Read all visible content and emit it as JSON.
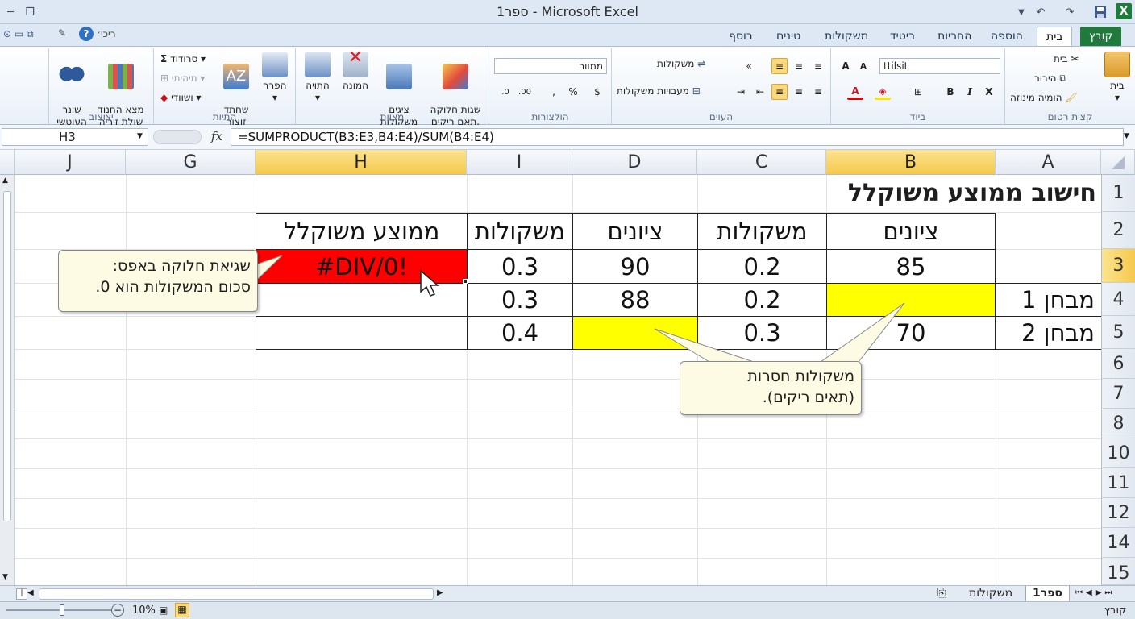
{
  "window": {
    "title": "ספר1 - Microsoft Excel"
  },
  "tabs": [
    {
      "label": "קובץ",
      "kind": "file"
    },
    {
      "label": "בית",
      "kind": "active"
    },
    {
      "label": "הוספה"
    },
    {
      "label": "החריות"
    },
    {
      "label": "ריטיד"
    },
    {
      "label": "משקולות"
    },
    {
      "label": "טינים"
    },
    {
      "label": "בוסף"
    }
  ],
  "qat": {
    "user": "ריכי׳"
  },
  "ribbon": {
    "clipboard": {
      "group": "קצית רטום",
      "paste": "בית",
      "cut": "בית",
      "copy": "היבור",
      "format_painter": "הומיה מינוזה"
    },
    "font": {
      "group": "ביוד",
      "font_name": "ttilsit"
    },
    "alignment": {
      "group": "העוים",
      "wrap": "משקולות",
      "merge": "מעבויות משקולות"
    },
    "number": {
      "group": "הולצורות",
      "format": "ממוור"
    },
    "styles": {
      "group": "מצוות",
      "b1": "שגות חלוקה\nתאם ריקים.",
      "b2": "ציגים\nמשקולות",
      "b3": "המונה",
      "b4": "התויה"
    },
    "cells": {
      "group": "התיות",
      "b1": "הפרר",
      "b2": "שחתד\nזוצור",
      "s1": "סרודוד",
      "s2": "תיהיתי",
      "s3": "ושוודי"
    },
    "editing": {
      "group": "יצוצוב",
      "b1": "מצא החנוד\nשולת זיריה",
      "b2": "שונר\nהעוטשי"
    }
  },
  "formula_bar": {
    "name_box": "H3",
    "fx": "fx",
    "formula": "=SUMPRODUCT(B3:E3,B4:E4)/SUM(B4:E4)"
  },
  "columns": [
    "A",
    "B",
    "C",
    "D",
    "I",
    "H",
    "G",
    "J"
  ],
  "rows": [
    "1",
    "2",
    "3",
    "4",
    "5",
    "6",
    "7",
    "8",
    "10",
    "11",
    "12",
    "14",
    "15"
  ],
  "sheet": {
    "title": "חישוב ממוצע משוקלל",
    "headers": {
      "B": "ציונים",
      "C": "משקולות",
      "D": "ציונים",
      "I": "משקולות",
      "H": "ממוצע משוקלל"
    },
    "row3": {
      "B": "85",
      "C": "0.2",
      "D": "90",
      "I": "0.3",
      "H": "#DIV/0!"
    },
    "row4": {
      "A": "מבחן 1",
      "B": "",
      "C": "0.2",
      "D": "88",
      "I": "0.3"
    },
    "row5": {
      "A": "מבחן 2",
      "B": "70",
      "C": "0.3",
      "D": "",
      "I": "0.4"
    }
  },
  "callouts": {
    "error": [
      "שגיאת חלוקה באפס:",
      "סכום המשקולות הוא 0."
    ],
    "missing": [
      "משקולות חסרות",
      "(תאים ריקים)."
    ]
  },
  "sheet_tabs": [
    "ספר1",
    "משקולות"
  ],
  "status": {
    "mode": "קובץ",
    "zoom": "10%"
  },
  "colors": {
    "error_fill": "#ff0000",
    "empty_fill": "#ffff00",
    "selected_header": "#f5c94b",
    "excel_green": "#1f7a3c"
  }
}
